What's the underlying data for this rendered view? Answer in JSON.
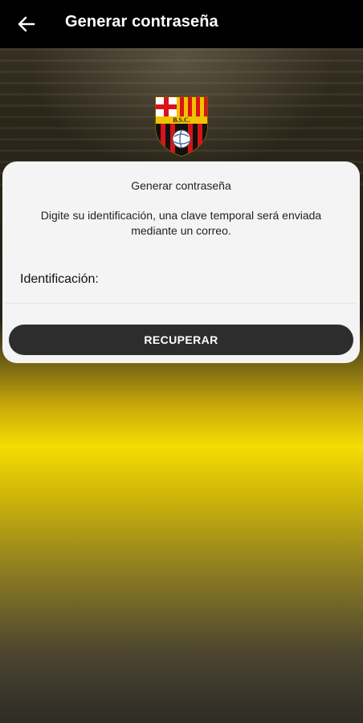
{
  "app_bar": {
    "title": "Generar contraseña",
    "back_icon": "arrow-left-icon"
  },
  "logo": {
    "name": "bsc-crest-logo",
    "text": "B.S.C."
  },
  "card": {
    "title": "Generar contraseña",
    "description": "Digite su identificación, una clave temporal será enviada mediante un correo.",
    "id_label": "Identificación:",
    "id_value": "",
    "button_label": "RECUPERAR"
  },
  "colors": {
    "app_bar": "#000000",
    "card": "#f4f4f4",
    "button": "#2d2d2d",
    "accent_yellow": "#f4dd02"
  }
}
